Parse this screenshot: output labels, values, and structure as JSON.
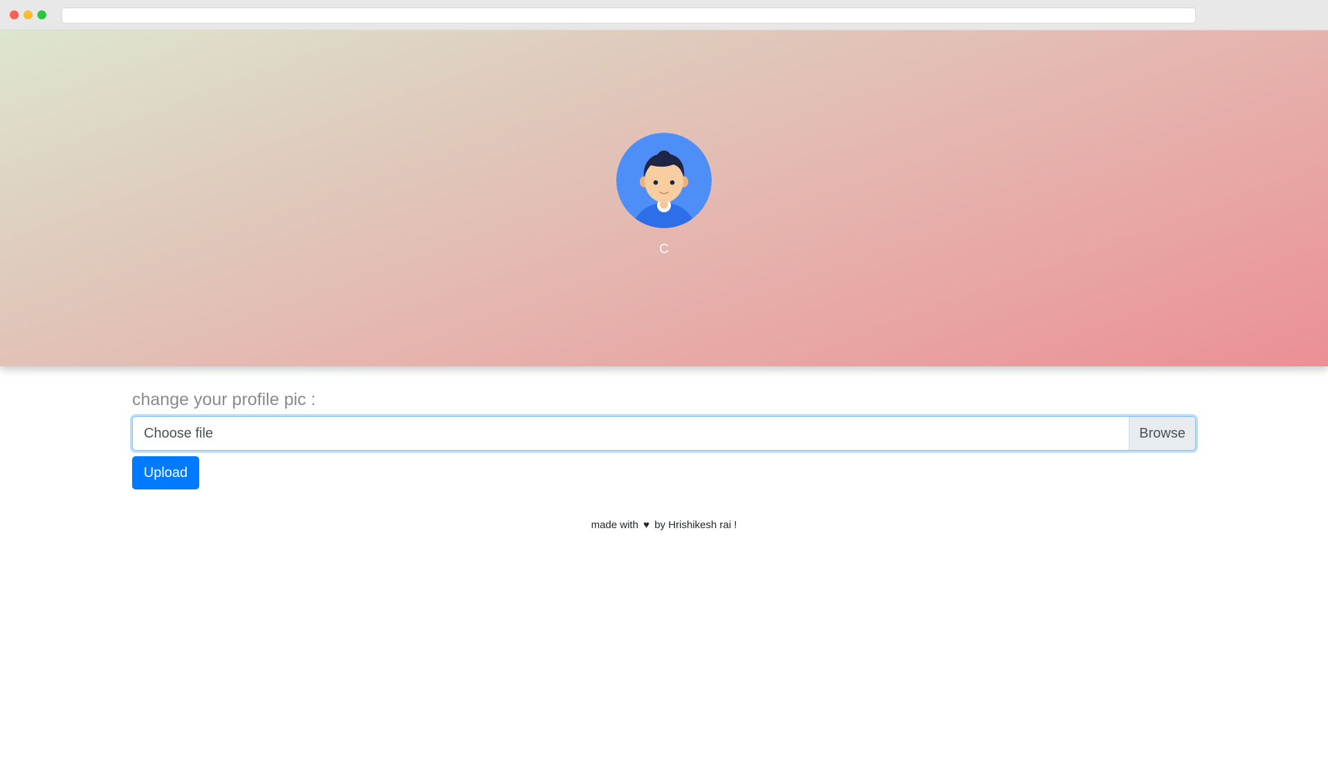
{
  "profile": {
    "name": "C",
    "avatar_icon": "user-avatar-icon",
    "avatar_bg_color": "#4e8ef7"
  },
  "upload": {
    "label": "change your profile pic :",
    "file_placeholder": "Choose file",
    "browse_label": "Browse",
    "upload_label": "Upload",
    "accent_color": "#007bff"
  },
  "footer": {
    "prefix": "made with",
    "heart_icon": "heart-icon",
    "heart_glyph": "♥",
    "suffix": "by Hrishikesh rai !"
  }
}
